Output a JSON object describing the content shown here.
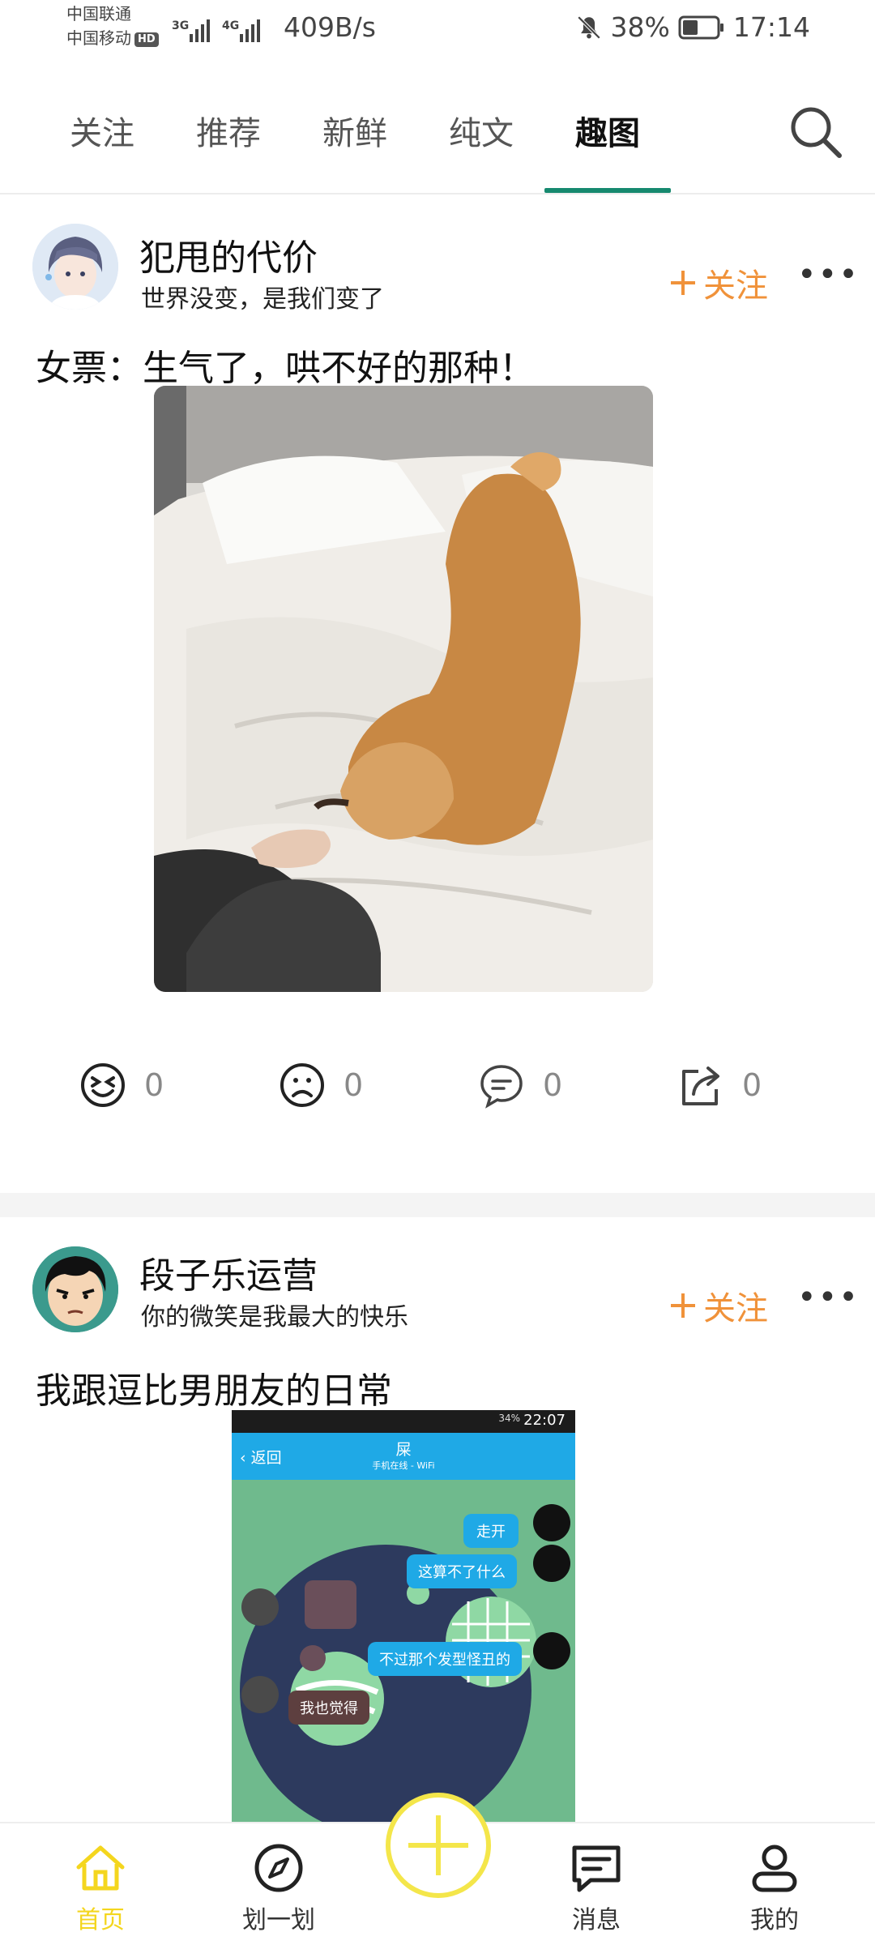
{
  "status_bar": {
    "carrier1": "中国联通",
    "carrier2": "中国移动",
    "hd_badge": "HD",
    "signal1": "3G",
    "signal2": "4G",
    "net_speed": "409B/s",
    "battery": "38%",
    "time": "17:14",
    "icons": [
      "mute-bell-icon",
      "battery-icon",
      "signal-icon"
    ]
  },
  "tabs": [
    {
      "label": "关注"
    },
    {
      "label": "推荐"
    },
    {
      "label": "新鲜"
    },
    {
      "label": "纯文"
    },
    {
      "label": "趣图",
      "active": true
    }
  ],
  "accent": {
    "tab_underline": "#16896f",
    "follow": "#f0923a",
    "nav_active": "#f4d61e"
  },
  "posts": [
    {
      "user": "犯甩的代价",
      "subtitle": "世界没变，是我们变了",
      "follow": "关注",
      "text": "女票：生气了，哄不好的那种！",
      "actions": {
        "laugh": "0",
        "sad": "0",
        "comment": "0",
        "share": "0"
      }
    },
    {
      "user": "段子乐运营",
      "subtitle": "你的微笑是我最大的快乐",
      "follow": "关注",
      "text": "我跟逗比男朋友的日常",
      "embedded": {
        "status_time": "22:07",
        "battery": "34%",
        "back": "返回",
        "chat_title": "屎",
        "chat_sub": "手机在线 - WiFi",
        "messages": [
          "走开",
          "这算不了什么",
          "不过那个发型怪丑的",
          "我也觉得"
        ]
      }
    }
  ],
  "nav": [
    {
      "label": "首页",
      "icon": "home-icon",
      "active": true
    },
    {
      "label": "划一划",
      "icon": "compass-icon"
    },
    {
      "label": "消息",
      "icon": "message-icon"
    },
    {
      "label": "我的",
      "icon": "profile-icon"
    }
  ]
}
